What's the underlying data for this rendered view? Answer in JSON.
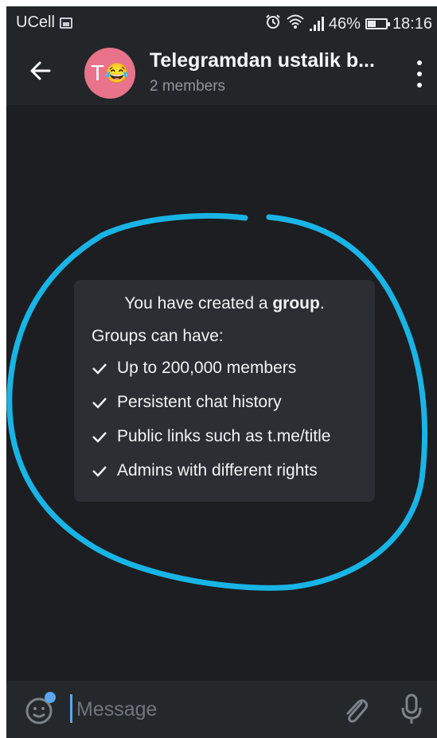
{
  "status_bar": {
    "carrier": "UCell",
    "battery_level": "46%",
    "battery_fraction": 0.46,
    "time": "18:16",
    "icons": [
      "image-icon",
      "alarm-icon",
      "wifi-icon",
      "signal-icon",
      "battery-icon"
    ]
  },
  "header": {
    "avatar_letter": "T",
    "avatar_emoji": "😂",
    "avatar_color": "#e8738b",
    "title": "Telegramdan ustalik b...",
    "subtitle": "2 members",
    "icons": [
      "back-arrow-icon",
      "more-vert-icon"
    ]
  },
  "service_message": {
    "intro_prefix": "You have created a ",
    "intro_bold": "group",
    "intro_suffix": ".",
    "subheading": "Groups can have:",
    "features": [
      "Up to 200,000 members",
      "Persistent chat history",
      "Public links such as t.me/title",
      "Admins with different rights"
    ],
    "check_icon": "check-icon"
  },
  "annotation": {
    "color": "#19b4e6",
    "shape": "hand-drawn-circle"
  },
  "composer": {
    "placeholder": "Message",
    "value": "",
    "accent_color": "#5aa7ef",
    "icons": [
      "emoji-icon",
      "attach-icon",
      "mic-icon"
    ]
  }
}
